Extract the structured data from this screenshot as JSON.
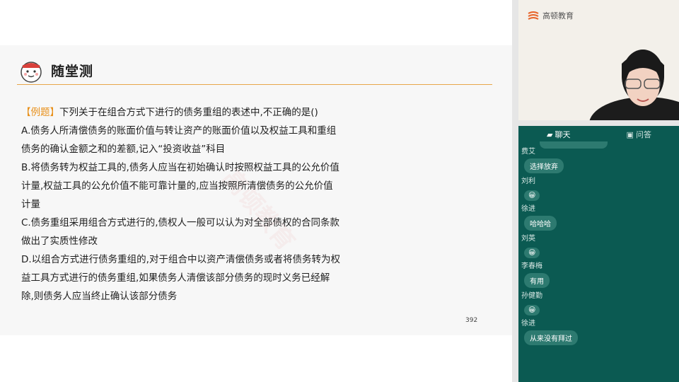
{
  "slide": {
    "title": "随堂测",
    "tag": "【例题】",
    "question": "下列关于在组合方式下进行的债务重组的表述中,不正确的是()",
    "lines": [
      "A.债务人所清偿债务的账面价值与转让资产的账面价值以及权益工具和重组",
      "债务的确认金额之和的差额,记入“投资收益”科目",
      "B.将债务转为权益工具的,债务人应当在初始确认时按照权益工具的公允价值",
      "计量,权益工具的公允价值不能可靠计量的,应当按照所清偿债务的公允价值",
      "计量",
      "C.债务重组采用组合方式进行的,债权人一般可以认为对全部债权的合同条款",
      "做出了实质性修改",
      "D.以组合方式进行债务重组的,对于组合中以资产清偿债务或者将债务转为权",
      "益工具方式进行的债务重组,如果债务人清偿该部分债务的现时义务已经解",
      "除,则债务人应当终止确认该部分债务"
    ],
    "page_number": "392",
    "watermark": "高顿教育",
    "accent_color": "#e8911c"
  },
  "video": {
    "logo_text": "高顿教育"
  },
  "chat": {
    "tabs": [
      {
        "label": "聊天",
        "icon": "chat-icon"
      },
      {
        "label": "问答",
        "icon": "qa-icon"
      }
    ],
    "messages": [
      {
        "user": "费艾",
        "text": "选择放弃"
      },
      {
        "user": "刘利",
        "text": "😀"
      },
      {
        "user": "徐进",
        "text": "哈哈哈"
      },
      {
        "user": "刘英",
        "text": "😀"
      },
      {
        "user": "李春梅",
        "text": "有用"
      },
      {
        "user": "孙健勤",
        "text": "😀"
      },
      {
        "user": "徐进",
        "text": "从来没有拜过"
      }
    ],
    "panel_color": "#0b5a52"
  }
}
